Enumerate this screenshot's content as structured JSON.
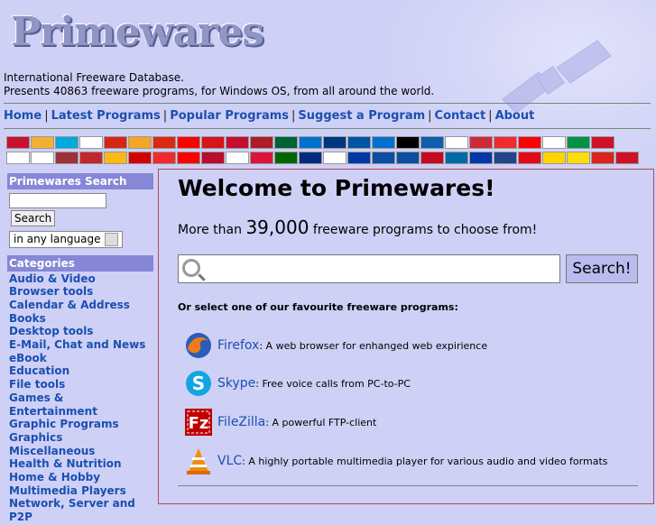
{
  "logo": "Primewares",
  "intro": {
    "line1": "International Freeware Database.",
    "line2": "Presents 40863 freeware programs, for Windows OS, from all around the world."
  },
  "nav": [
    {
      "label": "Home"
    },
    {
      "label": "Latest Programs"
    },
    {
      "label": "Popular Programs"
    },
    {
      "label": "Suggest a Program"
    },
    {
      "label": "Contact"
    },
    {
      "label": "About"
    }
  ],
  "flags_row1": [
    "#c8102e",
    "#f2b134",
    "#00aadd",
    "#ffffff",
    "#d62612",
    "#f5a623",
    "#de2910",
    "#ff0000",
    "#d7141a",
    "#c60c30",
    "#ae1c28",
    "#006233",
    "#0072ce",
    "#003580",
    "#0055a4",
    "#0072ce",
    "#000000",
    "#0d5eaf",
    "#ffffff",
    "#ce2939",
    "#ef2b2d",
    "#ff0000",
    "#ffffff",
    "#009246",
    "#ce1126"
  ],
  "flags_row2": [
    "#ffffff",
    "#ffffff",
    "#9e3039",
    "#c1272d",
    "#fdb913",
    "#d20000",
    "#ef2b2d",
    "#ff0000",
    "#ba0c2f",
    "#ffffff",
    "#dc143c",
    "#006600",
    "#002b7f",
    "#ffffff",
    "#0039a6",
    "#0b4ea2",
    "#0b4ea2",
    "#c60b1e",
    "#006aa7",
    "#0038a8",
    "#21468b",
    "#e30a17",
    "#ffd500",
    "#fcdd09",
    "#da251d",
    "#ce1126"
  ],
  "sidebar": {
    "search_title": "Primewares Search",
    "search_button": "Search",
    "language_value": "in any language",
    "categories_title": "Categories",
    "categories": [
      "Audio & Video",
      "Browser tools",
      "Calendar & Address Books",
      "Desktop tools",
      "E-Mail, Chat and News",
      "eBook",
      "Education",
      "File tools",
      "Games & Entertainment",
      "Graphic Programs",
      "Graphics Miscellaneous",
      "Health & Nutrition",
      "Home & Hobby",
      "Multimedia Players",
      "Network, Server and P2P"
    ]
  },
  "main": {
    "welcome": "Welcome to Primewares!",
    "more_prefix": "More than",
    "more_count": "39,000",
    "more_suffix": "freeware programs to choose from!",
    "search_button": "Search!",
    "select_text": "Or select one of our favourite freeware programs:",
    "favourites": [
      {
        "name": "Firefox",
        "desc": ": A web browser for enhanged web expirience",
        "icon": "firefox-icon"
      },
      {
        "name": "Skype",
        "desc": ": Free voice calls from PC-to-PC",
        "icon": "skype-icon"
      },
      {
        "name": "FileZilla",
        "desc": ": A powerful FTP-client",
        "icon": "filezilla-icon"
      },
      {
        "name": "VLC",
        "desc": ": A highly portable multimedia player for various audio and video formats",
        "icon": "vlc-icon"
      }
    ]
  }
}
